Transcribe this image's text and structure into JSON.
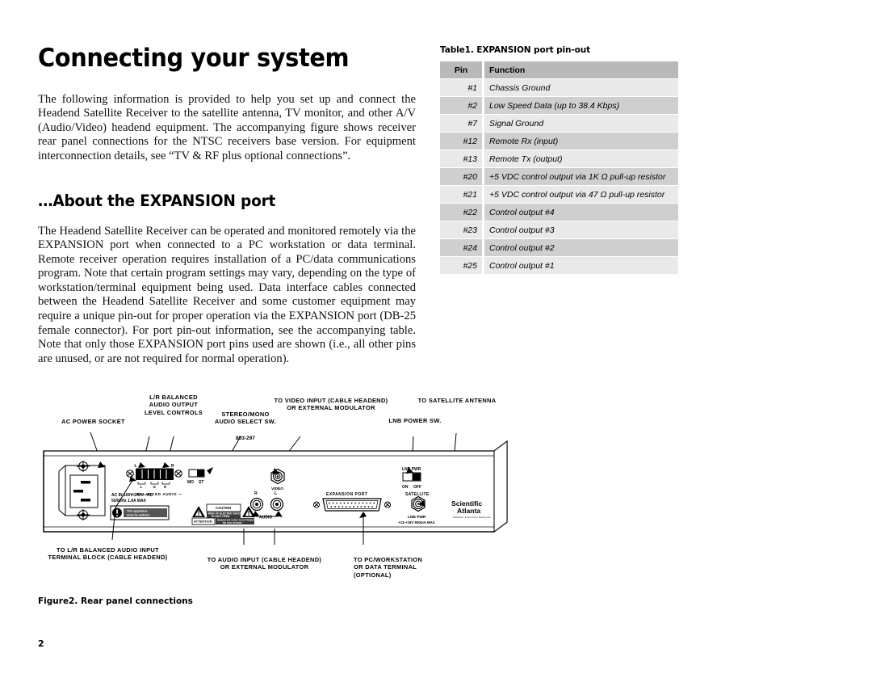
{
  "document": {
    "title": "Connecting your system",
    "page_number": "2",
    "intro_paragraph": "The following information is provided to help you set up and connect the Headend Satellite Receiver to the satellite antenna, TV monitor, and other A/V (Audio/Video) headend equipment. The accompanying figure shows receiver rear panel connections for the NTSC receivers base version. For equipment interconnection details, see “TV & RF plus optional connections”.",
    "section_heading": "…About the EXPANSION port",
    "section_paragraph": "The Headend Satellite Receiver can be operated and monitored remotely via the EXPANSION port when connected to a PC workstation or data terminal. Remote receiver operation requires installation of a PC/data communications program. Note that certain program settings may vary, depending on the type of workstation/terminal equipment being used. Data interface cables connected between the Headend Satellite Receiver and some customer equipment may require a unique pin-out for proper operation via the EXPANSION port (DB-25 female connector). For port pin-out information, see the accompanying table. Note that only those EXPANSION port pins used are shown (i.e., all other pins are unused, or are not required for normal operation)."
  },
  "table": {
    "caption": "Table1. EXPANSION port pin-out",
    "headers": [
      "Pin",
      "Function"
    ],
    "rows": [
      {
        "pin": "#1",
        "function": "Chassis Ground"
      },
      {
        "pin": "#2",
        "function": "Low Speed Data (up to 38.4 Kbps)"
      },
      {
        "pin": "#7",
        "function": "Signal Ground"
      },
      {
        "pin": "#12",
        "function": "Remote Rx (input)"
      },
      {
        "pin": "#13",
        "function": "Remote Tx (output)"
      },
      {
        "pin": "#20",
        "function": "+5 VDC control output via 1K Ω pull-up resistor"
      },
      {
        "pin": "#21",
        "function": "+5 VDC control output via 47 Ω pull-up resistor"
      },
      {
        "pin": "#22",
        "function": "Control output #4"
      },
      {
        "pin": "#23",
        "function": "Control output #3"
      },
      {
        "pin": "#24",
        "function": "Control output #2"
      },
      {
        "pin": "#25",
        "function": "Control output #1"
      }
    ],
    "colors": {
      "header_bg": "#b9b9b9",
      "row_light": "#e9e9e9",
      "row_dark": "#cfcfcf"
    }
  },
  "figure": {
    "caption": "Figure2. Rear panel connections",
    "drawing_number": "803-297",
    "callouts_top": [
      {
        "id": "ac-power-socket",
        "text": "AC POWER SOCKET"
      },
      {
        "id": "audio-level-controls",
        "text": "L/R BALANCED\nAUDIO OUTPUT\nLEVEL CONTROLS"
      },
      {
        "id": "audio-select-switch",
        "text": "STEREO/MONO\nAUDIO SELECT SW."
      },
      {
        "id": "video-input",
        "text": "TO VIDEO INPUT (CABLE HEADEND)\nOR EXTERNAL MODULATOR"
      },
      {
        "id": "lnb-power-switch",
        "text": "LNB POWER SW."
      },
      {
        "id": "satellite-antenna",
        "text": "TO SATELLITE ANTENNA"
      }
    ],
    "callouts_bottom": [
      {
        "id": "balanced-audio-input",
        "text": "TO  L/R BALANCED AUDIO INPUT\nTERMINAL BLOCK (CABLE HEADEND)"
      },
      {
        "id": "audio-input",
        "text": "TO AUDIO INPUT (CABLE HEADEND)\nOR EXTERNAL MODULATOR"
      },
      {
        "id": "pc-workstation",
        "text": "TO PC/WORKSTATION\nOR DATA TERMINAL\n(OPTIONAL)"
      }
    ],
    "panel_labels": {
      "ac_rating_line1": "AC IN 100V-240V ~AC",
      "ac_rating_line2": "50/60Hz 1.4A MAX",
      "earth_notice": "This apparatus\nmust be earthed",
      "caution_title": "CAUTION",
      "caution_body": "RISK OF ELECTRIC SHOCK\nDO NOT OPEN",
      "attention_label": "ATTENTION",
      "attention_body": "RISQUE DE CHOC ELECTRIQUE\nNE PAS OUVRIR",
      "balanced_audio": "BALANCED AUDIO",
      "terminal_L": "L",
      "terminal_R": "R",
      "terminal_G": "G",
      "switch_mono": "MO",
      "switch_stereo": "ST",
      "video": "VIDEO",
      "audio": "AUDIO",
      "audio_R": "R",
      "audio_L": "L",
      "expansion_port": "EXPANSION PORT",
      "satellite": "SATELLITE",
      "lnb_pwr_switch": "LNB PWR",
      "lnb_on": "ON",
      "lnb_off": "OFF",
      "lnb_pwr_jack": "LNB PWR",
      "lnb_rating": "+13-+19V 500mA MAX",
      "brand_line1": "Scientific",
      "brand_line2": "Atlanta",
      "brand_tagline": "Satellite Television Networks"
    }
  }
}
